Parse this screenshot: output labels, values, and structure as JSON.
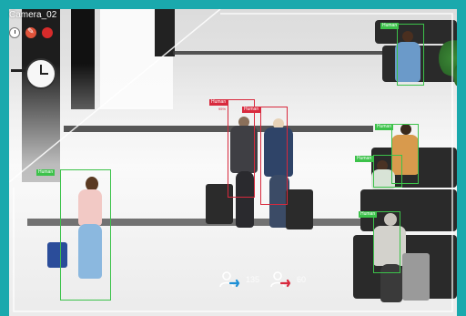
{
  "camera": {
    "title": "Camera_02"
  },
  "controls": [
    {
      "name": "clock-icon"
    },
    {
      "name": "tool-icon"
    },
    {
      "name": "record-icon"
    }
  ],
  "detections": [
    {
      "label": "Human",
      "confidence": "95%",
      "status": "red"
    },
    {
      "label": "Human",
      "confidence": "",
      "status": "red"
    },
    {
      "label": "Human",
      "confidence": "",
      "status": "green"
    },
    {
      "label": "Human",
      "confidence": "",
      "status": "green"
    },
    {
      "label": "Human",
      "confidence": "",
      "status": "green"
    },
    {
      "label": "Human",
      "confidence": "",
      "status": "green"
    },
    {
      "label": "Human",
      "confidence": "",
      "status": "green"
    }
  ],
  "counters": {
    "entered": "135",
    "exited": "60"
  },
  "colors": {
    "accent": "#1aa9ad",
    "detect_green": "#3cc24a",
    "detect_red": "#d8293d",
    "enter_arrow": "#1e90d6",
    "exit_arrow": "#d8293d"
  }
}
